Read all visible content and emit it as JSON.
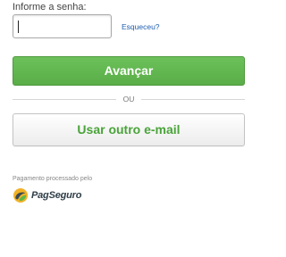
{
  "password": {
    "label": "Informe a senha:",
    "value": "",
    "placeholder": ""
  },
  "forgot_link": "Esqueceu?",
  "primary_button": {
    "label": "Avançar",
    "color": "#5cb34b"
  },
  "divider": {
    "label": "OU"
  },
  "secondary_button": {
    "label": "Usar outro e-mail",
    "text_color": "#4aa33a"
  },
  "footer": {
    "processed_label": "Pagamento processado pelo",
    "brand_name": "PagSeguro",
    "brand_icon": "pagseguro-logo-icon"
  }
}
